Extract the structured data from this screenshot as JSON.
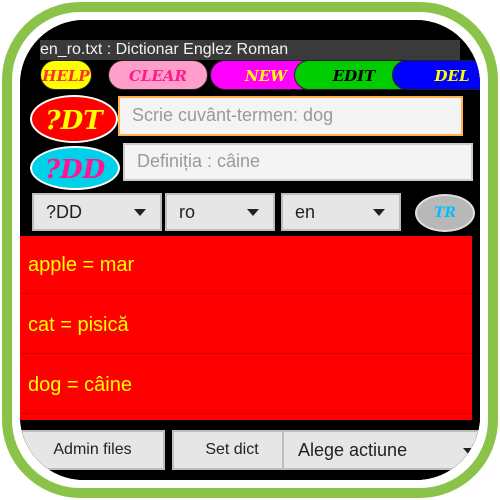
{
  "window": {
    "title": "en_ro.txt : Dictionar Englez Roman"
  },
  "toolbar": {
    "help_label": "HELP",
    "clear_label": "CLEAR",
    "new_label": "NEW",
    "edit_label": "EDIT",
    "delete_label": "DEL"
  },
  "search": {
    "term_button": "?DT",
    "definition_button": "?DD",
    "term_placeholder": "Scrie cuvânt-termen: dog",
    "definition_placeholder": "Definiția : câine"
  },
  "selectors": {
    "mode": "?DD",
    "from_lang": "ro",
    "to_lang": "en",
    "translate_label": "TR"
  },
  "results": [
    {
      "text": "apple = mar"
    },
    {
      "text": "cat = pisică"
    },
    {
      "text": "dog = câine"
    }
  ],
  "bottom": {
    "admin_label": "Admin files",
    "setdict_label": "Set dict",
    "action_select": "Alege actiune"
  },
  "colors": {
    "frame": "#8bc34a",
    "list_bg": "#ff0000",
    "list_text": "#ffff00"
  }
}
